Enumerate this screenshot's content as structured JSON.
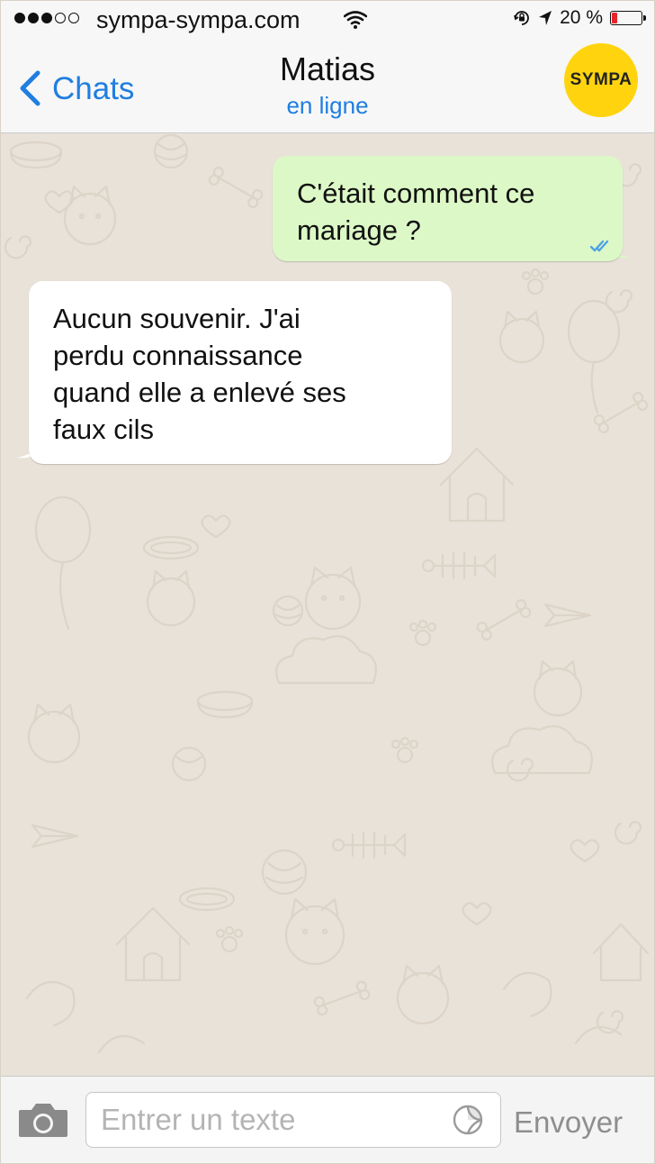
{
  "status_bar": {
    "carrier": "sympa-sympa.com",
    "battery_text": "20 %",
    "battery_level": 0.2,
    "signal_bars": 3,
    "signal_total": 5
  },
  "nav": {
    "back_label": "Chats",
    "contact_name": "Matias",
    "contact_status": "en ligne",
    "logo_text": "SYMPA"
  },
  "messages": [
    {
      "direction": "sent",
      "lines": [
        "C'était comment ce",
        "mariage ?"
      ],
      "read": true
    },
    {
      "direction": "received",
      "lines": [
        "Aucun souvenir. J'ai",
        "perdu connaissance",
        "quand elle a enlevé ses",
        "faux cils"
      ]
    }
  ],
  "input_bar": {
    "placeholder": "Entrer un texte",
    "send_label": "Envoyer"
  },
  "colors": {
    "accent": "#1f7ee0",
    "sent_bubble": "#dcf8c6",
    "received_bubble": "#ffffff",
    "chat_background": "#e9e2d9",
    "logo": "#ffd40f",
    "battery_low": "#e8242a"
  },
  "icons": [
    "wifi-icon",
    "lock-rotation-icon",
    "location-arrow-icon",
    "battery-icon",
    "chevron-left-icon",
    "double-check-icon",
    "camera-icon",
    "sticker-icon"
  ]
}
